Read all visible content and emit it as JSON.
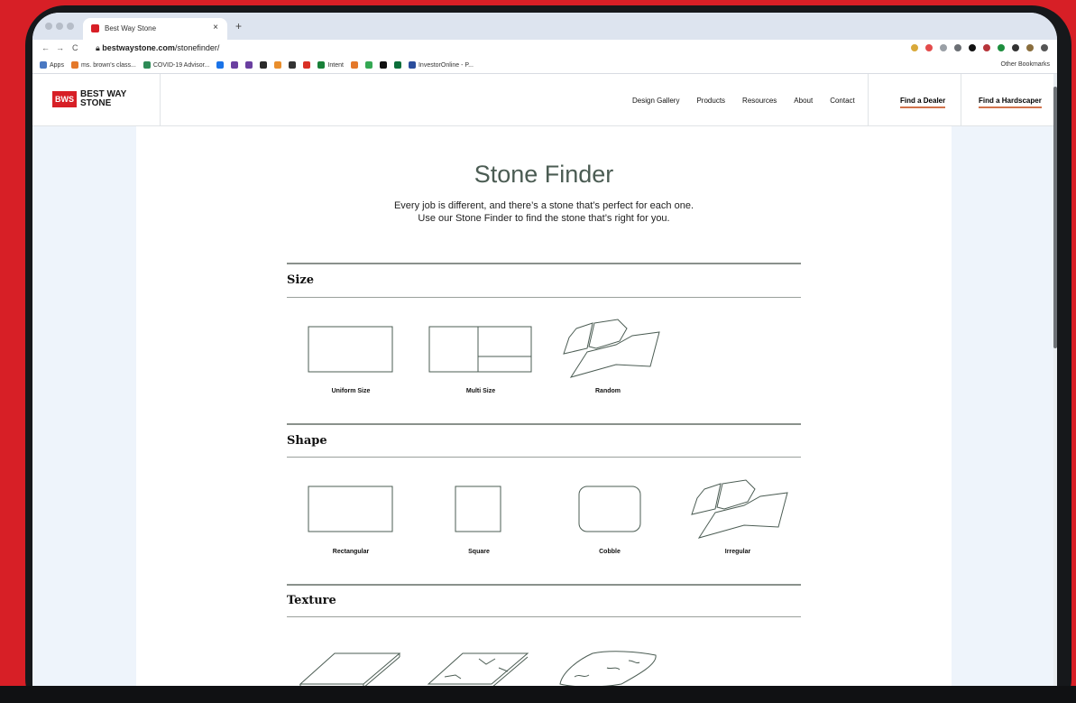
{
  "browser": {
    "tab_title": "Best Way Stone",
    "tab_close": "×",
    "new_tab": "+",
    "nav_back": "←",
    "nav_forward": "→",
    "nav_reload": "C",
    "url_host": "bestwaystone.com",
    "url_path": "/stonefinder/",
    "bookmarks": [
      {
        "label": "Apps",
        "color": "#4a78c2"
      },
      {
        "label": "ms. brown's class...",
        "color": "#e4782a"
      },
      {
        "label": "COVID-19 Advisor...",
        "color": "#2e8b57"
      },
      {
        "label": "",
        "color": "#1a73e8"
      },
      {
        "label": "",
        "color": "#6a3fa0"
      },
      {
        "label": "",
        "color": "#6a3fa0"
      },
      {
        "label": "",
        "color": "#2a2a2a"
      },
      {
        "label": "",
        "color": "#e98e2c"
      },
      {
        "label": "",
        "color": "#333333"
      },
      {
        "label": "",
        "color": "#d93025"
      },
      {
        "label": "Intent",
        "color": "#188038"
      },
      {
        "label": "",
        "color": "#e4782a"
      },
      {
        "label": "",
        "color": "#34a853"
      },
      {
        "label": "",
        "color": "#111111"
      },
      {
        "label": "",
        "color": "#0b6e3a"
      },
      {
        "label": "InvestorOnline - P...",
        "color": "#2b4d9c"
      }
    ],
    "other_bookmarks": "Other Bookmarks"
  },
  "site": {
    "logo_badge": "BWS",
    "logo_text": "BEST WAY STONE",
    "nav": [
      "Design Gallery",
      "Products",
      "Resources",
      "About",
      "Contact"
    ],
    "find_dealer": "Find a Dealer",
    "find_hardscaper": "Find a Hardscaper"
  },
  "finder": {
    "title": "Stone Finder",
    "subtitle_line1": "Every job is different, and there’s a stone that’s perfect for each one.",
    "subtitle_line2": "Use our Stone Finder to find the stone that’s right for you.",
    "sections": {
      "size": {
        "label": "Size",
        "options": [
          "Uniform Size",
          "Multi Size",
          "Random"
        ]
      },
      "shape": {
        "label": "Shape",
        "options": [
          "Rectangular",
          "Square",
          "Cobble",
          "Irregular"
        ]
      },
      "texture": {
        "label": "Texture",
        "options": []
      }
    }
  },
  "colors": {
    "brand_red": "#d71f26",
    "accent_underline": "#d2734c",
    "heading_green": "#4b5c53"
  }
}
